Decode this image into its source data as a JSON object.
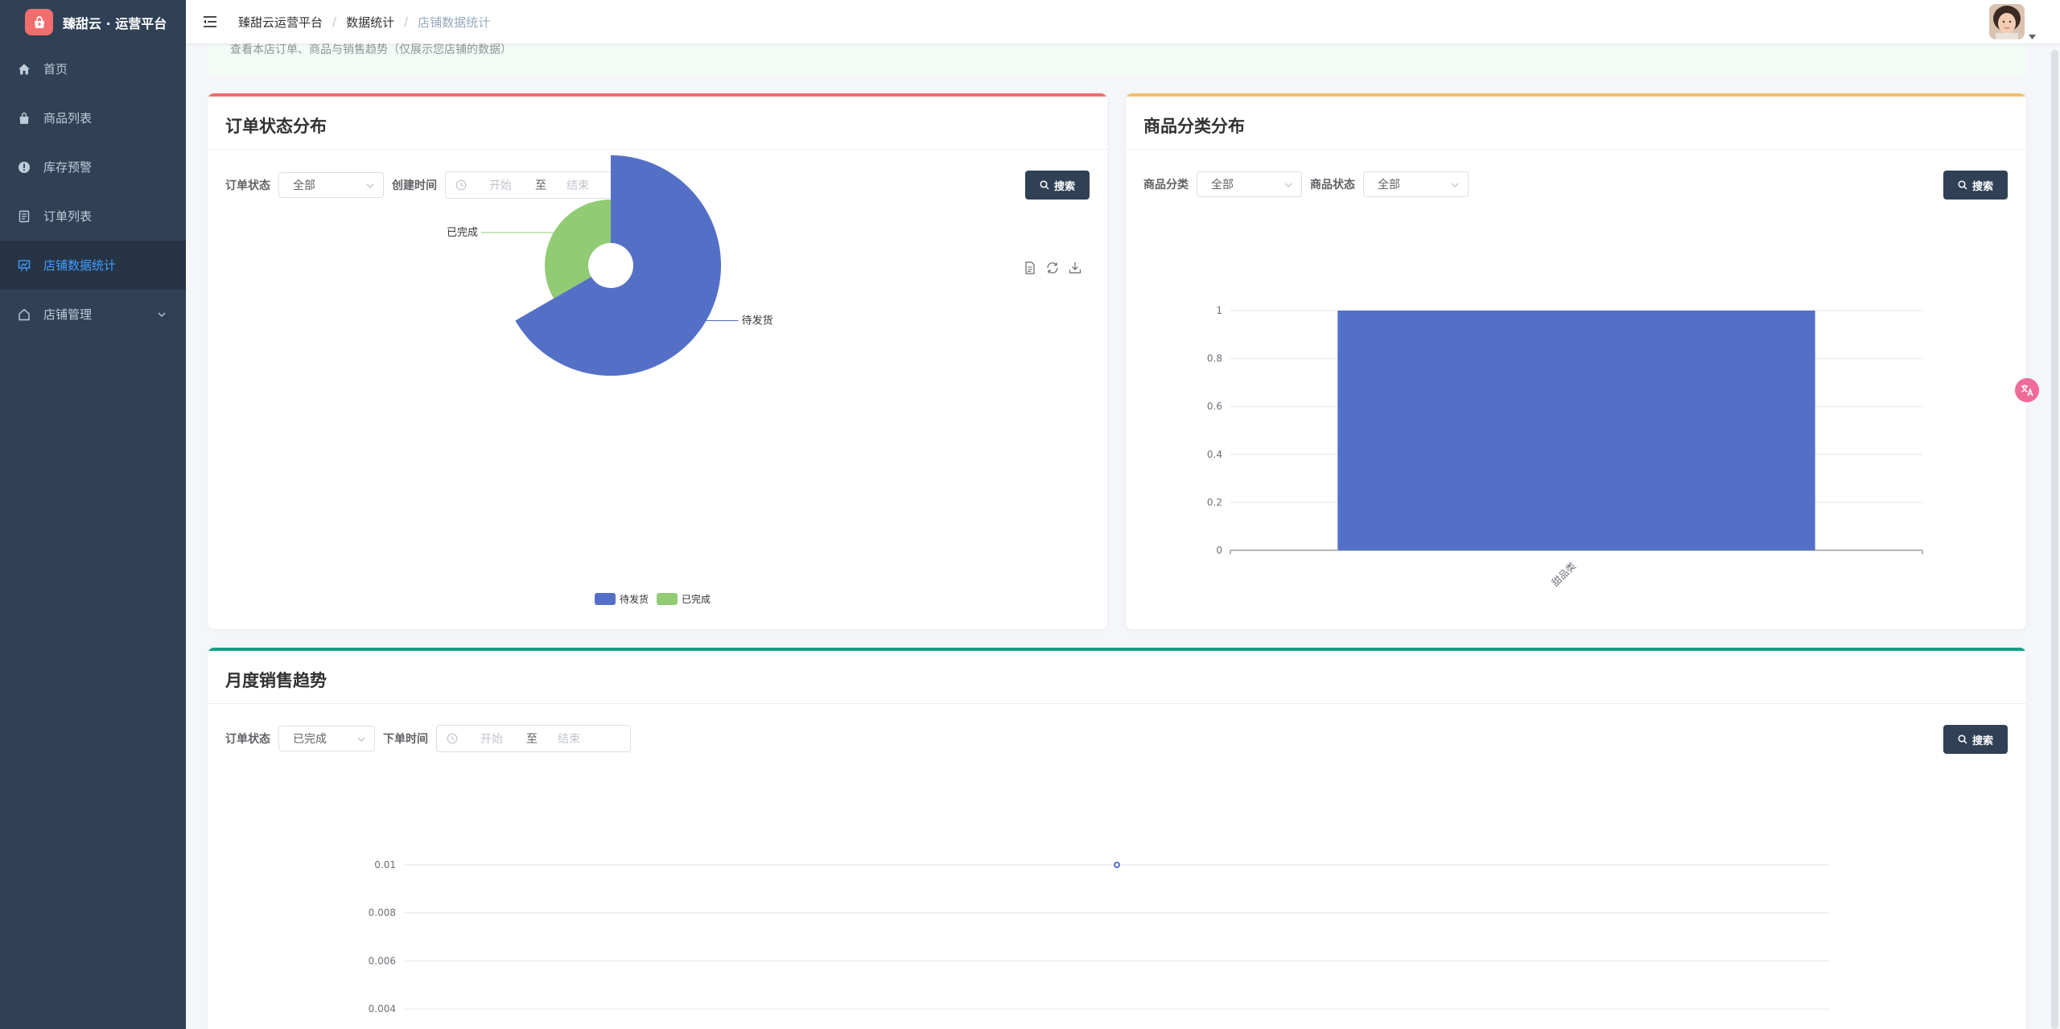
{
  "app": {
    "title": "臻甜云 · 运营平台"
  },
  "sidebar": {
    "items": [
      {
        "label": "首页",
        "icon": "home-icon"
      },
      {
        "label": "商品列表",
        "icon": "shopping-bag-icon"
      },
      {
        "label": "库存预警",
        "icon": "warning-icon"
      },
      {
        "label": "订单列表",
        "icon": "document-icon"
      },
      {
        "label": "店铺数据统计",
        "icon": "chart-icon",
        "active": true
      },
      {
        "label": "店铺管理",
        "icon": "store-icon",
        "has_submenu": true
      }
    ]
  },
  "breadcrumb": [
    "臻甜云运营平台",
    "数据统计",
    "店铺数据统计"
  ],
  "page": {
    "description": "查看本店订单、商品与销售趋势（仅展示您店铺的数据）"
  },
  "order_status_card": {
    "title": "订单状态分布",
    "filters": {
      "status_label": "订单状态",
      "status_value": "全部",
      "time_label": "创建时间",
      "start_placeholder": "开始",
      "range_sep": "至",
      "end_placeholder": "结束"
    },
    "search_label": "搜索",
    "toolbox": [
      "data-view-icon",
      "restore-icon",
      "save-image-icon"
    ]
  },
  "category_card": {
    "title": "商品分类分布",
    "filters": {
      "category_label": "商品分类",
      "category_value": "全部",
      "status_label": "商品状态",
      "status_value": "全部"
    },
    "search_label": "搜索"
  },
  "monthly_card": {
    "title": "月度销售趋势",
    "filters": {
      "status_label": "订单状态",
      "status_value": "已完成",
      "time_label": "下单时间",
      "start_placeholder": "开始",
      "range_sep": "至",
      "end_placeholder": "结束"
    },
    "search_label": "搜索"
  },
  "colors": {
    "sidebar": "#304156",
    "accent": "#409eff",
    "pie_pending": "#5470c6",
    "pie_done": "#91cc75"
  },
  "chart_data": [
    {
      "type": "pie",
      "chart": "order_status",
      "rose": true,
      "slices": [
        {
          "name": "待发货",
          "value": 2,
          "color": "#5470c6"
        },
        {
          "name": "已完成",
          "value": 1,
          "color": "#91cc75"
        }
      ],
      "legend": [
        "待发货",
        "已完成"
      ],
      "legend_position": "bottom"
    },
    {
      "type": "bar",
      "chart": "category",
      "categories": [
        "甜品类"
      ],
      "values": [
        1
      ],
      "ylim": [
        0,
        1
      ],
      "yticks": [
        "0",
        "0.2",
        "0.4",
        "0.6",
        "0.8",
        "1"
      ],
      "color": "#5470c6"
    },
    {
      "type": "line",
      "chart": "monthly",
      "points": [
        {
          "y": 0.01
        }
      ],
      "yticks": [
        "0.004",
        "0.006",
        "0.008",
        "0.01"
      ],
      "color": "#5470c6"
    }
  ]
}
